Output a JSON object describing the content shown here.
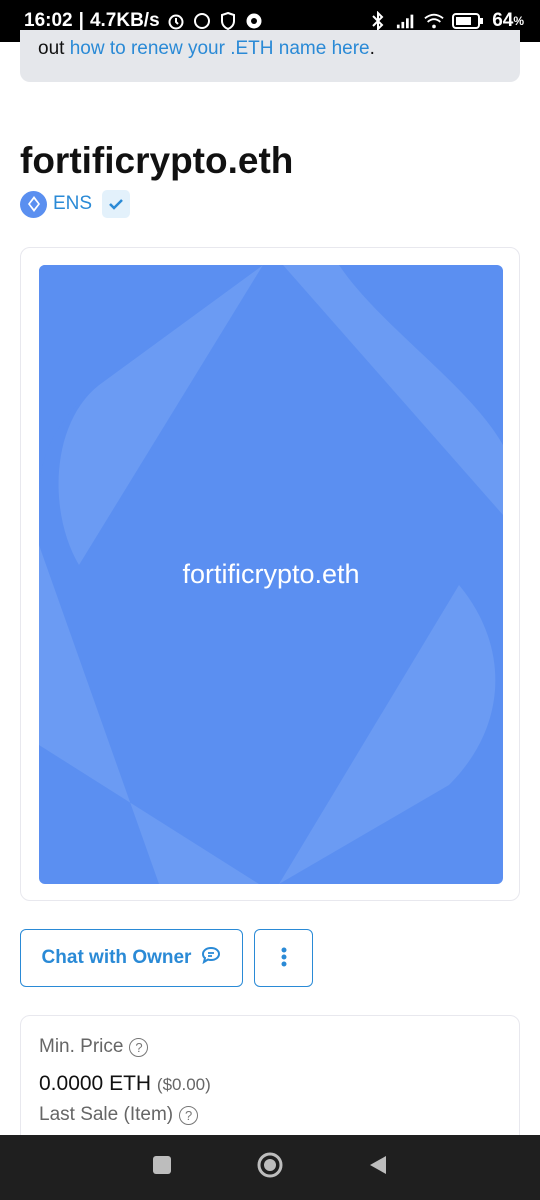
{
  "status_bar": {
    "time": "16:02",
    "speed": "4.7KB/s",
    "battery": "64"
  },
  "notice": {
    "prefix": "out ",
    "link": "how to renew your .ETH name here",
    "suffix": "."
  },
  "item": {
    "title": "fortificrypto.eth",
    "collection": "ENS",
    "image_label": "fortificrypto.eth"
  },
  "actions": {
    "chat_label": "Chat with Owner"
  },
  "pricing": {
    "min_price_label": "Min. Price",
    "min_price_value": "0.0000 ETH",
    "min_price_usd": "($0.00)",
    "last_sale_label": "Last Sale (Item)"
  },
  "colors": {
    "accent": "#2a8ad6",
    "nft_bg": "#5b8ff1"
  }
}
